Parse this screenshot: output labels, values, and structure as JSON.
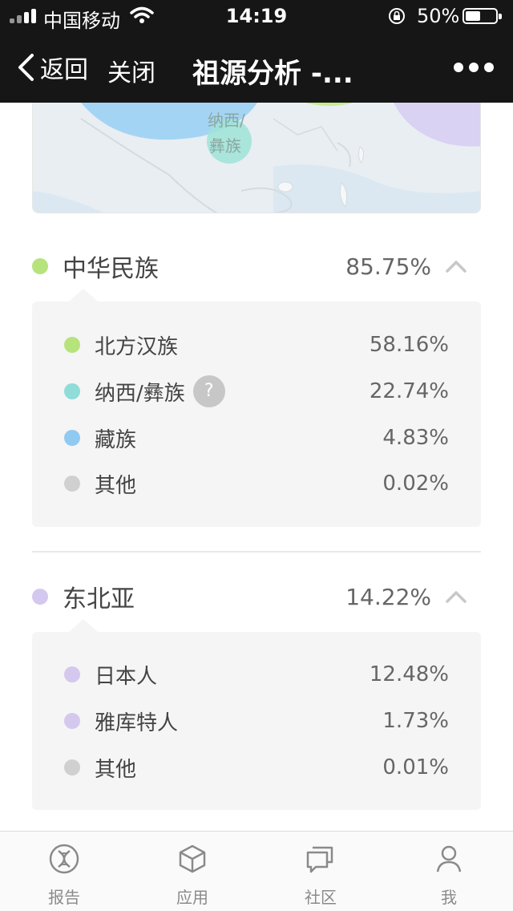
{
  "status_bar": {
    "carrier": "中国移动",
    "time": "14:19",
    "battery_percent": "50%",
    "icons": [
      "signal-icon",
      "wifi-icon",
      "orientation-lock-icon",
      "battery-icon"
    ]
  },
  "nav": {
    "back_label": "返回",
    "close_label": "关闭",
    "title": "祖源分析 -...",
    "icons": [
      "chevron-left-icon",
      "more-icon"
    ]
  },
  "map": {
    "label_line1": "纳西/",
    "label_line2": "彝族"
  },
  "groups": [
    {
      "name": "中华民族",
      "percent": "85.75%",
      "color": "#b7e37c",
      "items": [
        {
          "name": "北方汉族",
          "percent": "58.16%",
          "color": "#b7e37c"
        },
        {
          "name": "纳西/彝族",
          "percent": "22.74%",
          "color": "#8fdcd8",
          "help": "?"
        },
        {
          "name": "藏族",
          "percent": "4.83%",
          "color": "#90c9f2"
        },
        {
          "name": "其他",
          "percent": "0.02%",
          "color": "#d0d0d0"
        }
      ]
    },
    {
      "name": "东北亚",
      "percent": "14.22%",
      "color": "#d5c8ee",
      "items": [
        {
          "name": "日本人",
          "percent": "12.48%",
          "color": "#d5c8ee"
        },
        {
          "name": "雅库特人",
          "percent": "1.73%",
          "color": "#d5c8ee"
        },
        {
          "name": "其他",
          "percent": "0.01%",
          "color": "#d0d0d0"
        }
      ]
    }
  ],
  "tabs": [
    {
      "label": "报告",
      "icon": "dna-report-icon"
    },
    {
      "label": "应用",
      "icon": "cube-icon"
    },
    {
      "label": "社区",
      "icon": "chat-bubbles-icon"
    },
    {
      "label": "我",
      "icon": "person-icon"
    }
  ]
}
